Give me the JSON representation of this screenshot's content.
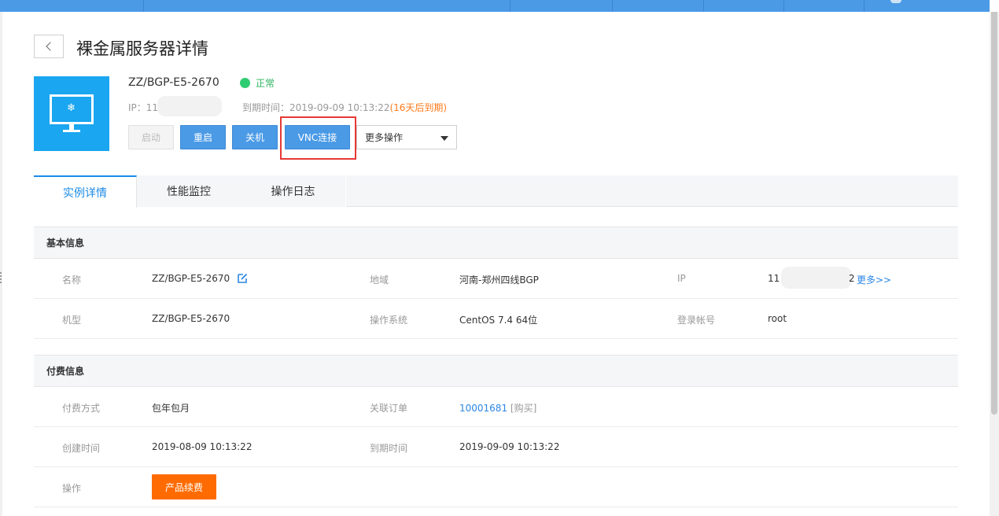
{
  "page": {
    "title": "裸金属服务器详情"
  },
  "server": {
    "name": "ZZ/BGP-E5-2670",
    "status": "正常",
    "ip_prefix": "IP：11",
    "expire_label": "到期时间：",
    "expire_value": "2019-09-09 10:13:22",
    "expire_warning": "(16天后到期)"
  },
  "actions": {
    "start": "启动",
    "restart": "重启",
    "stop": "关机",
    "vnc": "VNC连接",
    "more": "更多操作"
  },
  "tabs": [
    {
      "label": "实例详情"
    },
    {
      "label": "性能监控"
    },
    {
      "label": "操作日志"
    }
  ],
  "basic": {
    "title": "基本信息",
    "name_label": "名称",
    "name_value": "ZZ/BGP-E5-2670",
    "region_label": "地域",
    "region_value": "河南-郑州四线BGP",
    "ip_label": "IP",
    "ip_value_start": "11",
    "ip_value_end": "2",
    "ip_more": "更多>>",
    "model_label": "机型",
    "model_value": "ZZ/BGP-E5-2670",
    "os_label": "操作系统",
    "os_value": "CentOS 7.4 64位",
    "account_label": "登录帐号",
    "account_value": "root"
  },
  "billing": {
    "title": "付费信息",
    "method_label": "付费方式",
    "method_value": "包年包月",
    "order_label": "关联订单",
    "order_value": "10001681",
    "order_type": "[购买]",
    "created_label": "创建时间",
    "created_value": "2019-08-09 10:13:22",
    "expire_label": "到期时间",
    "expire_value": "2019-09-09 10:13:22",
    "op_label": "操作",
    "renew": "产品续费"
  }
}
